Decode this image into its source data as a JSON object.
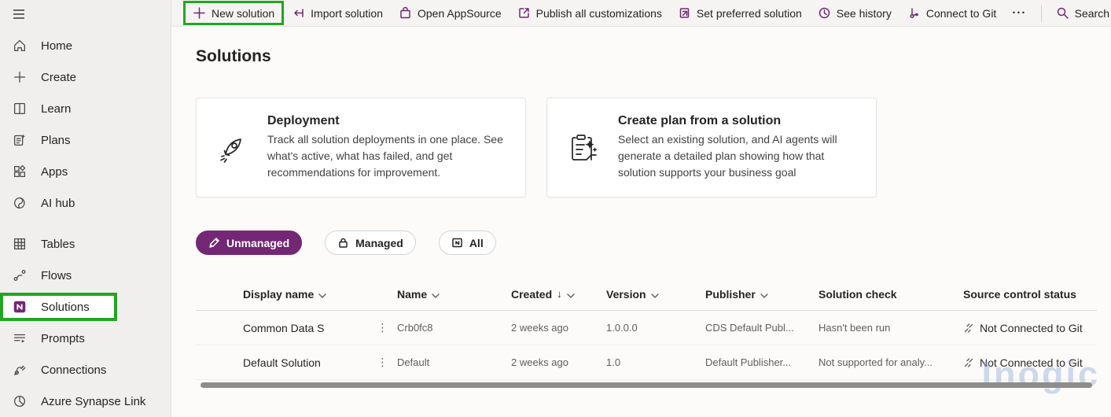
{
  "colors": {
    "accent_purple": "#742774",
    "annotation_green": "#23a522",
    "selected_pill_bg": "#742774",
    "sidebar_bg": "#f1efed",
    "watermark_blue": "#8ea9d6"
  },
  "sidebar": {
    "items": [
      {
        "label": "Home",
        "icon": "home-icon"
      },
      {
        "label": "Create",
        "icon": "plus-icon"
      },
      {
        "label": "Learn",
        "icon": "book-icon"
      },
      {
        "label": "Plans",
        "icon": "plans-icon"
      },
      {
        "label": "Apps",
        "icon": "apps-icon"
      },
      {
        "label": "AI hub",
        "icon": "ai-hub-icon"
      },
      {
        "label": "Tables",
        "icon": "tables-icon"
      },
      {
        "label": "Flows",
        "icon": "flows-icon"
      },
      {
        "label": "Solutions",
        "icon": "solutions-icon",
        "selected": true,
        "annotated": true
      },
      {
        "label": "Prompts",
        "icon": "prompts-icon"
      },
      {
        "label": "Connections",
        "icon": "connections-icon"
      },
      {
        "label": "Azure Synapse Link",
        "icon": "synapse-icon"
      }
    ]
  },
  "command_bar": {
    "items": [
      {
        "label": "New solution",
        "icon": "plus-icon",
        "annotated": true
      },
      {
        "label": "Import solution",
        "icon": "import-icon"
      },
      {
        "label": "Open AppSource",
        "icon": "appsource-bag-icon"
      },
      {
        "label": "Publish all customizations",
        "icon": "publish-icon"
      },
      {
        "label": "Set preferred solution",
        "icon": "preferred-solution-icon"
      },
      {
        "label": "See history",
        "icon": "history-clock-icon"
      },
      {
        "label": "Connect to Git",
        "icon": "git-branch-icon"
      }
    ],
    "overflow_label": "···",
    "search_label": "Search"
  },
  "page": {
    "title": "Solutions",
    "cards": [
      {
        "title": "Deployment",
        "description": "Track all solution deployments in one place. See what's active, what has failed, and get recommendations for improvement.",
        "icon": "rocket-icon"
      },
      {
        "title": "Create plan from a solution",
        "description": "Select an existing solution, and AI agents will generate a detailed plan showing how that solution supports your business goal",
        "icon": "clipboard-sparkle-icon"
      }
    ],
    "filters": [
      {
        "label": "Unmanaged",
        "icon": "pencil-icon",
        "selected": true
      },
      {
        "label": "Managed",
        "icon": "lock-icon"
      },
      {
        "label": "All",
        "icon": "all-solutions-icon"
      }
    ],
    "table": {
      "columns": [
        {
          "label": "Display name",
          "sortable": true
        },
        {
          "label": "Name",
          "sortable": true
        },
        {
          "label": "Created",
          "sortable": true,
          "sorted": "desc"
        },
        {
          "label": "Version",
          "sortable": true
        },
        {
          "label": "Publisher",
          "sortable": true
        },
        {
          "label": "Solution check",
          "sortable": false
        },
        {
          "label": "Source control status",
          "sortable": false
        }
      ],
      "rows": [
        {
          "display_name": "Common Data S",
          "name": "Crb0fc8",
          "created": "2 weeks ago",
          "version": "1.0.0.0",
          "publisher": "CDS Default Publ...",
          "solution_check": "Hasn't been run",
          "source_control_status": "Not Connected to Git"
        },
        {
          "display_name": "Default Solution",
          "name": "Default",
          "created": "2 weeks ago",
          "version": "1.0",
          "publisher": "Default Publisher...",
          "solution_check": "Not supported for analy...",
          "source_control_status": "Not Connected to Git"
        }
      ]
    },
    "watermark": "Inogic"
  }
}
